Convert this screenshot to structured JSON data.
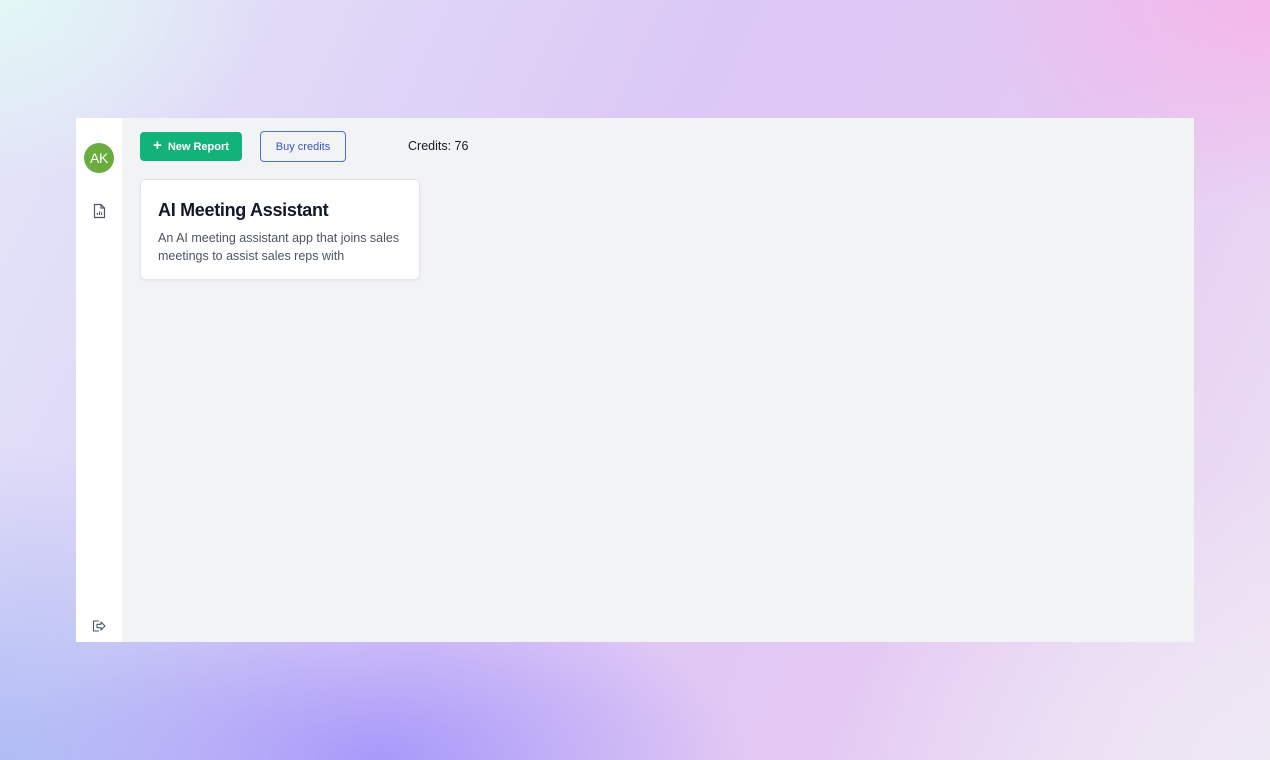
{
  "sidebar": {
    "avatar_initials": "AK",
    "avatar_color": "#6aac3d",
    "nav": [
      {
        "icon": "report-document-icon"
      }
    ],
    "logout_icon": "logout-icon"
  },
  "toolbar": {
    "new_report_label": "New Report",
    "new_report_icon": "plus-icon",
    "new_report_color": "#12b27a",
    "buy_credits_label": "Buy credits",
    "buy_credits_color": "#3a55c8",
    "credits_text": "Credits: 76"
  },
  "reports": [
    {
      "title": "AI Meeting Assistant",
      "description": "An AI meeting assistant app that joins sales meetings to assist sales reps with"
    }
  ]
}
